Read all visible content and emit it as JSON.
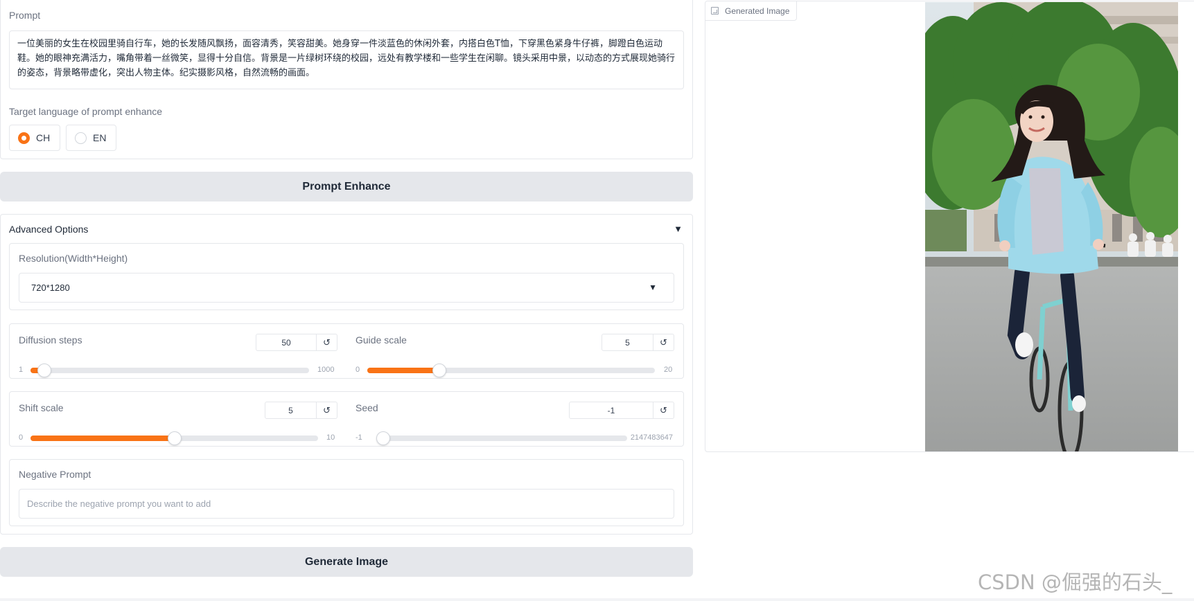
{
  "prompt": {
    "label": "Prompt",
    "value": "一位美丽的女生在校园里骑自行车，她的长发随风飘扬，面容清秀，笑容甜美。她身穿一件淡蓝色的休闲外套，内搭白色T恤，下穿黑色紧身牛仔裤，脚蹬白色运动鞋。她的眼神充满活力，嘴角带着一丝微笑，显得十分自信。背景是一片绿树环绕的校园，远处有教学楼和一些学生在闲聊。镜头采用中景，以动态的方式展现她骑行的姿态，背景略带虚化，突出人物主体。纪实摄影风格，自然流畅的画面。"
  },
  "target_language": {
    "label": "Target language of prompt enhance",
    "options": [
      {
        "label": "CH",
        "checked": true
      },
      {
        "label": "EN",
        "checked": false
      }
    ]
  },
  "prompt_enhance_button": "Prompt Enhance",
  "advanced": {
    "title": "Advanced Options",
    "resolution": {
      "label": "Resolution(Width*Height)",
      "value": "720*1280"
    },
    "sliders": [
      {
        "name": "Diffusion steps",
        "value": "50",
        "min": "1",
        "max": "1000",
        "fraction": 0.049
      },
      {
        "name": "Guide scale",
        "value": "5",
        "min": "0",
        "max": "20",
        "fraction": 0.25
      },
      {
        "name": "Shift scale",
        "value": "5",
        "min": "0",
        "max": "10",
        "fraction": 0.5
      },
      {
        "name": "Seed",
        "value": "-1",
        "min": "-1",
        "max": "2147483647",
        "fraction": 0.0
      }
    ],
    "reset_glyph": "↺",
    "negative_prompt": {
      "label": "Negative Prompt",
      "placeholder": "Describe the negative prompt you want to add"
    }
  },
  "generate_button": "Generate Image",
  "output": {
    "label": "Generated Image"
  },
  "watermark": "CSDN @倔强的石头_",
  "colors": {
    "accent": "#f97316",
    "button_bg": "#e5e7eb",
    "border": "#e5e7eb"
  }
}
